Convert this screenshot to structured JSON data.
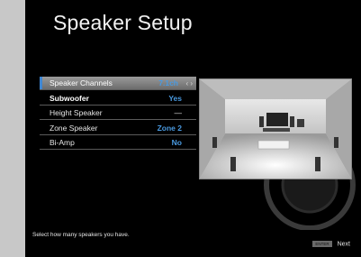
{
  "title": "Speaker Setup",
  "menu": {
    "items": [
      {
        "label": "Speaker Channels",
        "value": "7.1ch",
        "arrows": "‹ ›"
      },
      {
        "label": "Subwoofer",
        "value": "Yes"
      },
      {
        "label": "Height Speaker",
        "value": "—"
      },
      {
        "label": "Zone Speaker",
        "value": "Zone 2"
      },
      {
        "label": "Bi-Amp",
        "value": "No"
      }
    ]
  },
  "help_text": "Select how many speakers you have.",
  "footer": {
    "key_label": "ENTER",
    "next_label": "Next"
  },
  "colors": {
    "accent": "#4a9ae0",
    "selection_bar": "#3f86d2",
    "background": "#000000"
  }
}
